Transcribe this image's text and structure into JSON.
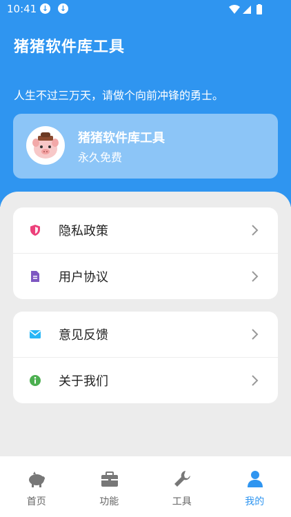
{
  "status_bar": {
    "time": "10:41"
  },
  "header": {
    "app_title": "猪猪软件库工具",
    "motto": "人生不过三万天，请做个向前冲锋的勇士。"
  },
  "profile_card": {
    "title": "猪猪软件库工具",
    "subtitle": "永久免费",
    "avatar_icon": "pig-avatar-icon"
  },
  "menu_groups": [
    {
      "items": [
        {
          "label": "隐私政策",
          "icon": "shield-icon",
          "color": "#ec407a"
        },
        {
          "label": "用户协议",
          "icon": "document-icon",
          "color": "#7e57c2"
        }
      ]
    },
    {
      "items": [
        {
          "label": "意见反馈",
          "icon": "mail-icon",
          "color": "#29b6f6"
        },
        {
          "label": "关于我们",
          "icon": "info-icon",
          "color": "#4caf50"
        }
      ]
    }
  ],
  "tab_bar": {
    "tabs": [
      {
        "label": "首页",
        "icon": "piggy-bank-icon",
        "active": false
      },
      {
        "label": "功能",
        "icon": "toolbox-icon",
        "active": false
      },
      {
        "label": "工具",
        "icon": "wrench-icon",
        "active": false
      },
      {
        "label": "我的",
        "icon": "person-icon",
        "active": true
      }
    ]
  },
  "colors": {
    "primary": "#2f95f0",
    "background": "#ececec",
    "text": "#222222"
  }
}
